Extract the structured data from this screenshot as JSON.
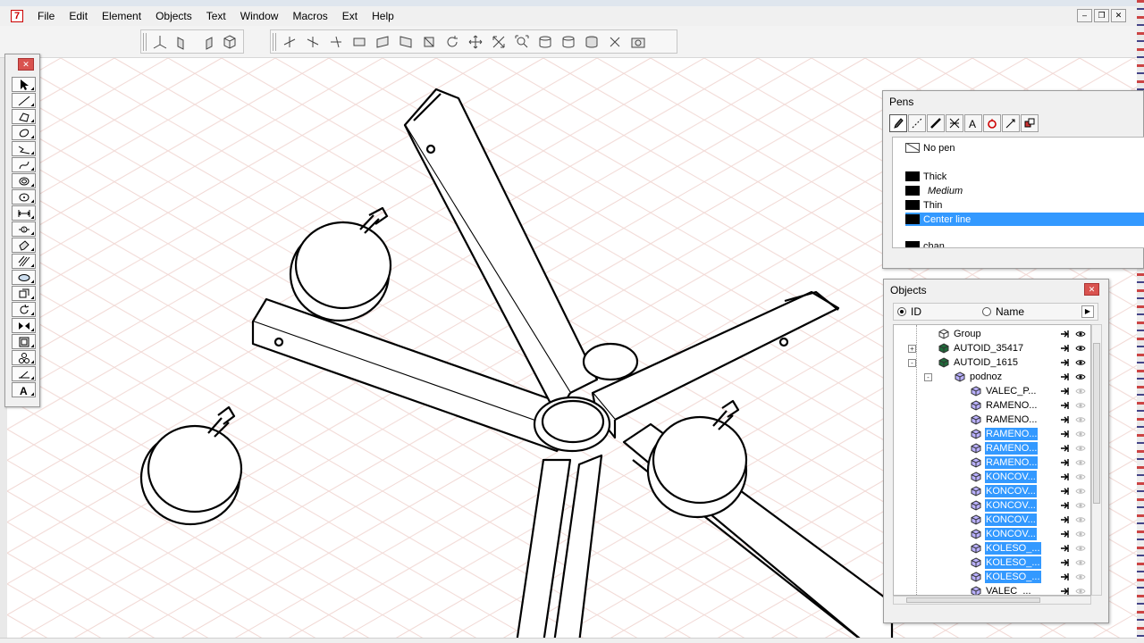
{
  "app": {
    "icon_glyph": "7"
  },
  "menu": [
    "File",
    "Edit",
    "Element",
    "Objects",
    "Text",
    "Window",
    "Macros",
    "Ext",
    "Help"
  ],
  "window_buttons": [
    "minimize",
    "restore",
    "close"
  ],
  "toolbar": {
    "group1_icons": [
      "iso-axes-icon",
      "iso-plane-left-icon",
      "iso-plane-right-icon",
      "iso-cube-icon"
    ],
    "group2_icons": [
      "axis-tool-icon",
      "axis-tool-2-icon",
      "axis-tool-3-icon",
      "transform-icon",
      "transform-2-icon",
      "transform-3-icon",
      "transform-4-icon",
      "rotate-icon",
      "move-icon",
      "scale-icon",
      "zoom-fit-icon",
      "cylinder-icon",
      "cylinder-2-icon",
      "cylinder-3-icon",
      "cross-icon",
      "camera-icon"
    ]
  },
  "tool_palette": {
    "tools": [
      "select-arrow-icon",
      "line-icon",
      "polygon-icon",
      "ellipse-icon",
      "zigzag-icon",
      "curve-icon",
      "circle-icon",
      "circle-point-icon",
      "dimension-icon",
      "dimension-2-icon",
      "paint-icon",
      "hatch-icon",
      "ellipse-tool-icon",
      "box-icon",
      "rotate-tool-icon",
      "mirror-icon",
      "frame-icon",
      "component-icon",
      "slope-icon",
      "text-tool-icon"
    ]
  },
  "pens": {
    "title": "Pens",
    "tabs": [
      "pen-icon",
      "dashed-pen-icon",
      "line-weight-icon",
      "cross-hatch-icon",
      "text-pen-icon",
      "fill-pen-icon",
      "arrow-pen-icon",
      "styles-pen-icon"
    ],
    "rows": [
      {
        "label": "No pen",
        "swatch": "none",
        "italic": false
      },
      {
        "label": "Thick",
        "swatch": "black",
        "italic": false
      },
      {
        "label": "Medium",
        "swatch": "black",
        "italic": true
      },
      {
        "label": "Thin",
        "swatch": "black",
        "italic": false
      },
      {
        "label": "Center line",
        "swatch": "black",
        "italic": false,
        "selected": true
      },
      {
        "label": "chan",
        "swatch": "black",
        "italic": false
      }
    ]
  },
  "objects": {
    "title": "Objects",
    "radio_id": "ID",
    "radio_name": "Name",
    "rows": [
      {
        "label": "Group",
        "icon": "group",
        "depth": 0,
        "selected": false
      },
      {
        "label": "AUTOID_35417",
        "icon": "solid-green",
        "depth": 0,
        "expander": "+",
        "selected": false
      },
      {
        "label": "AUTOID_1615",
        "icon": "solid-green",
        "depth": 0,
        "expander": "-",
        "selected": false
      },
      {
        "label": "podnoz",
        "icon": "part",
        "depth": 1,
        "expander": "-",
        "selected": false
      },
      {
        "label": "VALEC_P...",
        "icon": "part",
        "depth": 2,
        "selected": false
      },
      {
        "label": "RAMENO...",
        "icon": "part",
        "depth": 2,
        "selected": false
      },
      {
        "label": "RAMENO...",
        "icon": "part",
        "depth": 2,
        "selected": false
      },
      {
        "label": "RAMENO...",
        "icon": "part",
        "depth": 2,
        "selected": true
      },
      {
        "label": "RAMENO...",
        "icon": "part",
        "depth": 2,
        "selected": true
      },
      {
        "label": "RAMENO...",
        "icon": "part",
        "depth": 2,
        "selected": true
      },
      {
        "label": "KONCOV...",
        "icon": "part",
        "depth": 2,
        "selected": true
      },
      {
        "label": "KONCOV...",
        "icon": "part",
        "depth": 2,
        "selected": true
      },
      {
        "label": "KONCOV...",
        "icon": "part",
        "depth": 2,
        "selected": true
      },
      {
        "label": "KONCOV...",
        "icon": "part",
        "depth": 2,
        "selected": true
      },
      {
        "label": "KONCOV...",
        "icon": "part",
        "depth": 2,
        "selected": true
      },
      {
        "label": "KOLESO_...",
        "icon": "part",
        "depth": 2,
        "selected": true
      },
      {
        "label": "KOLESO_...",
        "icon": "part",
        "depth": 2,
        "selected": true
      },
      {
        "label": "KOLESO_...",
        "icon": "part",
        "depth": 2,
        "selected": true
      },
      {
        "label": "VALEC_...",
        "icon": "part",
        "depth": 2,
        "selected": false
      }
    ]
  },
  "colors": {
    "selection": "#3399ff",
    "grid_line": "#f1d8d4",
    "close_red": "#d9534f"
  }
}
